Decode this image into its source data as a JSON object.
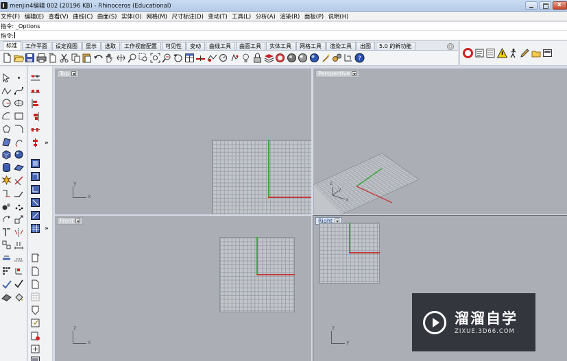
{
  "window": {
    "title": "menjin4编辑 002 (20196 KB) - Rhinoceros (Educational)"
  },
  "menu": [
    "文件(F)",
    "编辑(E)",
    "查看(V)",
    "曲线(C)",
    "曲面(S)",
    "实体(O)",
    "网格(M)",
    "尺寸标注(D)",
    "变动(T)",
    "工具(L)",
    "分析(A)",
    "渲染(R)",
    "面板(P)",
    "说明(H)"
  ],
  "command": {
    "history_label": "指令:",
    "history_value": "_Options",
    "prompt_label": "指令:",
    "prompt_value": ""
  },
  "tabs": [
    "标准",
    "工作平面",
    "设定视图",
    "显示",
    "选取",
    "工作视窗配置",
    "可见性",
    "变动",
    "曲线工具",
    "曲面工具",
    "实体工具",
    "网格工具",
    "渲染工具",
    "出图",
    "5.0 的新功能"
  ],
  "viewports": {
    "top": "Top",
    "perspective": "Perspective",
    "front": "Front",
    "right": "Right"
  },
  "axis_labels": {
    "x": "x",
    "y": "y",
    "z": "z"
  },
  "watermark": {
    "cn": "溜溜自学",
    "en": "ZIXUE.3D66.COM"
  },
  "colors": {
    "viewport_bg": "#abafb5",
    "grid": "#c2c5ca",
    "x_axis": "#c23b3b",
    "y_axis": "#3ea53e",
    "watermark_bg": "#22252c"
  }
}
